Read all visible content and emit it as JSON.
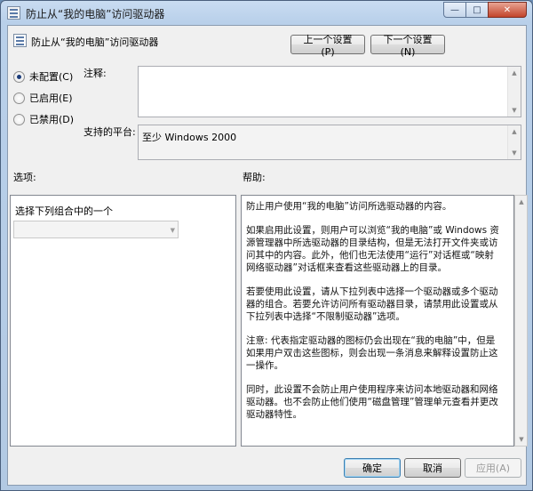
{
  "window": {
    "title": "防止从“我的电脑”访问驱动器",
    "minimize_glyph": "—",
    "maximize_glyph": "□",
    "close_glyph": "✕"
  },
  "header": {
    "title": "防止从“我的电脑”访问驱动器",
    "prev_button": "上一个设置(P)",
    "next_button": "下一个设置(N)"
  },
  "state": {
    "options": [
      {
        "label": "未配置(C)",
        "checked": true
      },
      {
        "label": "已启用(E)",
        "checked": false
      },
      {
        "label": "已禁用(D)",
        "checked": false
      }
    ]
  },
  "comment": {
    "label": "注释:",
    "value": ""
  },
  "platform": {
    "label": "支持的平台:",
    "value": "至少 Windows 2000"
  },
  "options_section": {
    "label": "选项:",
    "combo_label": "选择下列组合中的一个",
    "combo_value": ""
  },
  "help_section": {
    "label": "帮助:",
    "paragraphs": [
      "防止用户使用“我的电脑”访问所选驱动器的内容。",
      "如果启用此设置，则用户可以浏览“我的电脑”或 Windows 资源管理器中所选驱动器的目录结构，但是无法打开文件夹或访问其中的内容。此外，他们也无法使用“运行”对话框或“映射网络驱动器”对话框来查看这些驱动器上的目录。",
      "若要使用此设置，请从下拉列表中选择一个驱动器或多个驱动器的组合。若要允许访问所有驱动器目录，请禁用此设置或从下拉列表中选择“不限制驱动器”选项。",
      "注意: 代表指定驱动器的图标仍会出现在“我的电脑”中，但是如果用户双击这些图标，则会出现一条消息来解释设置防止这一操作。",
      "同时，此设置不会防止用户使用程序来访问本地驱动器和网络驱动器。也不会防止他们使用“磁盘管理”管理单元查看并更改驱动器特性。"
    ]
  },
  "footer": {
    "ok": "确定",
    "cancel": "取消",
    "apply": "应用(A)"
  },
  "colors": {
    "title_gradient_top": "#c9dcf1",
    "client_bg": "#f0f0f0",
    "close_button": "#c2442b"
  }
}
